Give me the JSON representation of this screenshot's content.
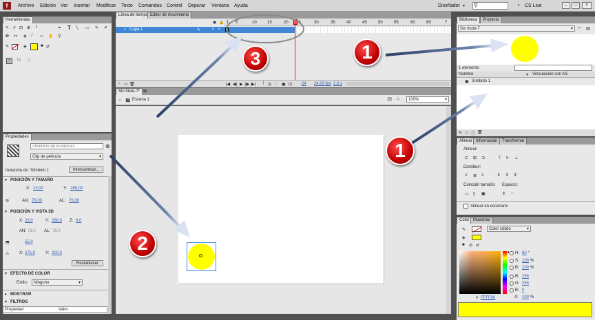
{
  "menubar": {
    "items": [
      "Archivo",
      "Edición",
      "Ver",
      "Insertar",
      "Modificar",
      "Texto",
      "Comandos",
      "Control",
      "Depurar",
      "Ventana",
      "Ayuda"
    ],
    "workspace": "Diseñador",
    "cs_live": "CS Live"
  },
  "tools": {
    "title": "Herramientas"
  },
  "timeline": {
    "tabs": [
      "Línea de tiempo",
      "Editor de movimiento"
    ],
    "layer": "Capa 1",
    "ruler": [
      "1",
      "5",
      "10",
      "15",
      "20",
      "25",
      "30",
      "35",
      "40",
      "45",
      "50",
      "55",
      "60",
      "65",
      "7"
    ],
    "frame": "24",
    "fps": "24,00 fps",
    "time": "1,0 s"
  },
  "document": {
    "tab": "Sin título-7*",
    "scene": "Escena 1",
    "zoom": "100%"
  },
  "properties": {
    "tab": "Propiedades",
    "instance_name_placeholder": "<Nombre de instancia>",
    "type": "Clip de película",
    "instance_of_label": "Instancia de:",
    "instance_of_value": "Símbolo 1",
    "swap_button": "Intercambiar...",
    "pos_size_header": "POSICIÓN Y TAMAÑO",
    "x_label": "X:",
    "x_value": "23,00",
    "y_label": "Y:",
    "y_value": "288,00",
    "w_label": "AN:",
    "w_value": "76,00",
    "h_label": "AL:",
    "h_value": "76,00",
    "pos3d_header": "POSICIÓN Y VISTA 3D",
    "x3d_value": "23,0",
    "y3d_value": "288,0",
    "z_label": "Z:",
    "z3d_value": "0,0",
    "w3d_value": "76,0",
    "h3d_value": "76,0",
    "persp_value": "55,0",
    "vx_value": "275,0",
    "vy_value": "200,0",
    "reset_button": "Restablecer",
    "color_effect_header": "EFECTO DE COLOR",
    "style_label": "Estilo:",
    "style_value": "Ninguno",
    "display_header": "MOSTRAR",
    "filters_header": "FILTROS",
    "col_property": "Propiedad",
    "col_value": "Valor"
  },
  "library": {
    "tabs": [
      "Biblioteca",
      "Proyecto"
    ],
    "doc": "Sin título-7",
    "count": "1 elemento",
    "col_name": "Nombre",
    "col_link": "Vinculación con AS",
    "item": "Símbolo 1"
  },
  "align": {
    "tabs": [
      "Alinear",
      "Información",
      "Transformar"
    ],
    "align_label": "Alinear:",
    "distribute_label": "Distribuir:",
    "match_label": "Coincidir tamaño:",
    "space_label": "Espacio:",
    "stage_label": "Alinear en escenario"
  },
  "color": {
    "tabs": [
      "Color",
      "Muestras"
    ],
    "type": "Color sólido",
    "h": "60",
    "s": "100",
    "b": "100",
    "r": "255",
    "g": "255",
    "bl": "0",
    "hex": "FFFF00",
    "alpha": "100",
    "h_label": "H:",
    "s_label": "S:",
    "b_label": "B:",
    "r_label": "R:",
    "g_label": "G:",
    "bl_label": "B:",
    "a_label": "A:",
    "hash": "#",
    "deg": "°",
    "pct": "%",
    "fill_color": "#FFFF00"
  },
  "annotations": [
    "1",
    "2",
    "3",
    "1"
  ]
}
